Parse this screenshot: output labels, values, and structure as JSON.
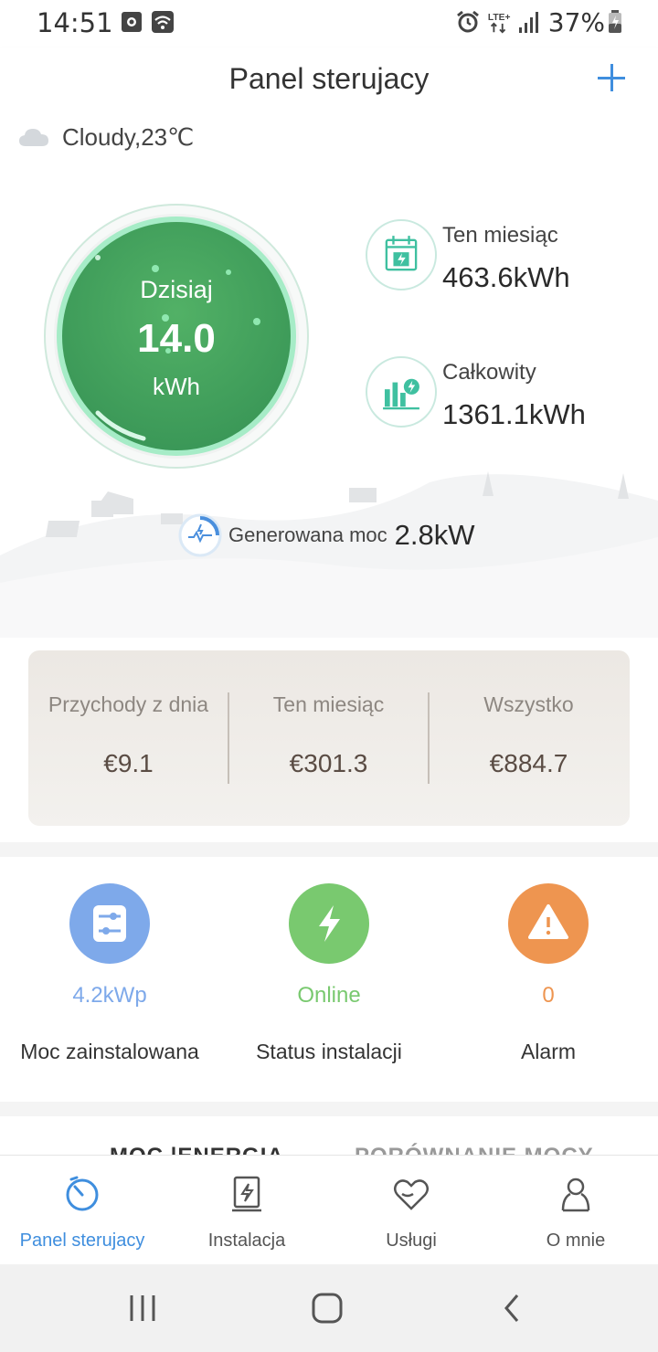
{
  "status_bar": {
    "time": "14:51",
    "network": "LTE+",
    "battery": "37%",
    "icons": [
      "gallery-icon",
      "wifi-icon",
      "alarm-icon",
      "lte-icon",
      "signal-icon",
      "battery-icon"
    ]
  },
  "header": {
    "title": "Panel sterujacy",
    "add_icon": "plus-icon"
  },
  "weather": {
    "icon": "cloud-icon",
    "text": "Cloudy,23℃"
  },
  "today": {
    "label": "Dzisiaj",
    "value": "14.0",
    "unit": "kWh"
  },
  "stats": [
    {
      "label": "Ten miesiąc",
      "value": "463.6kWh",
      "icon": "calendar-energy-icon"
    },
    {
      "label": "Całkowity",
      "value": "1361.1kWh",
      "icon": "bar-chart-energy-icon"
    }
  ],
  "power": {
    "label": "Generowana moc",
    "value": "2.8kW",
    "icon": "power-gauge-icon"
  },
  "income": [
    {
      "label": "Przychody z dnia",
      "value": "€9.1"
    },
    {
      "label": "Ten miesiąc",
      "value": "€301.3"
    },
    {
      "label": "Wszystko",
      "value": "€884.7"
    }
  ],
  "status": [
    {
      "value": "4.2kWp",
      "label": "Moc zainstalowana",
      "icon": "sliders-icon",
      "color": "#7ea9ea"
    },
    {
      "value": "Online",
      "label": "Status instalacji",
      "icon": "lightning-icon",
      "color": "#79c96f"
    },
    {
      "value": "0",
      "label": "Alarm",
      "icon": "warning-icon",
      "color": "#ee9550"
    }
  ],
  "tabs": [
    {
      "label": "MOC |ENERGIA",
      "active": true
    },
    {
      "label": "PORÓWNANIE MOCY",
      "active": false
    }
  ],
  "bottom_nav": [
    {
      "label": "Panel sterujacy",
      "icon": "dashboard-icon",
      "active": true
    },
    {
      "label": "Instalacja",
      "icon": "installation-icon",
      "active": false
    },
    {
      "label": "Usługi",
      "icon": "services-heart-icon",
      "active": false
    },
    {
      "label": "O mnie",
      "icon": "profile-icon",
      "active": false
    }
  ],
  "colors": {
    "accent": "#3f8ede",
    "gauge_green": "#46a35e",
    "teal": "#3fc0a0"
  }
}
